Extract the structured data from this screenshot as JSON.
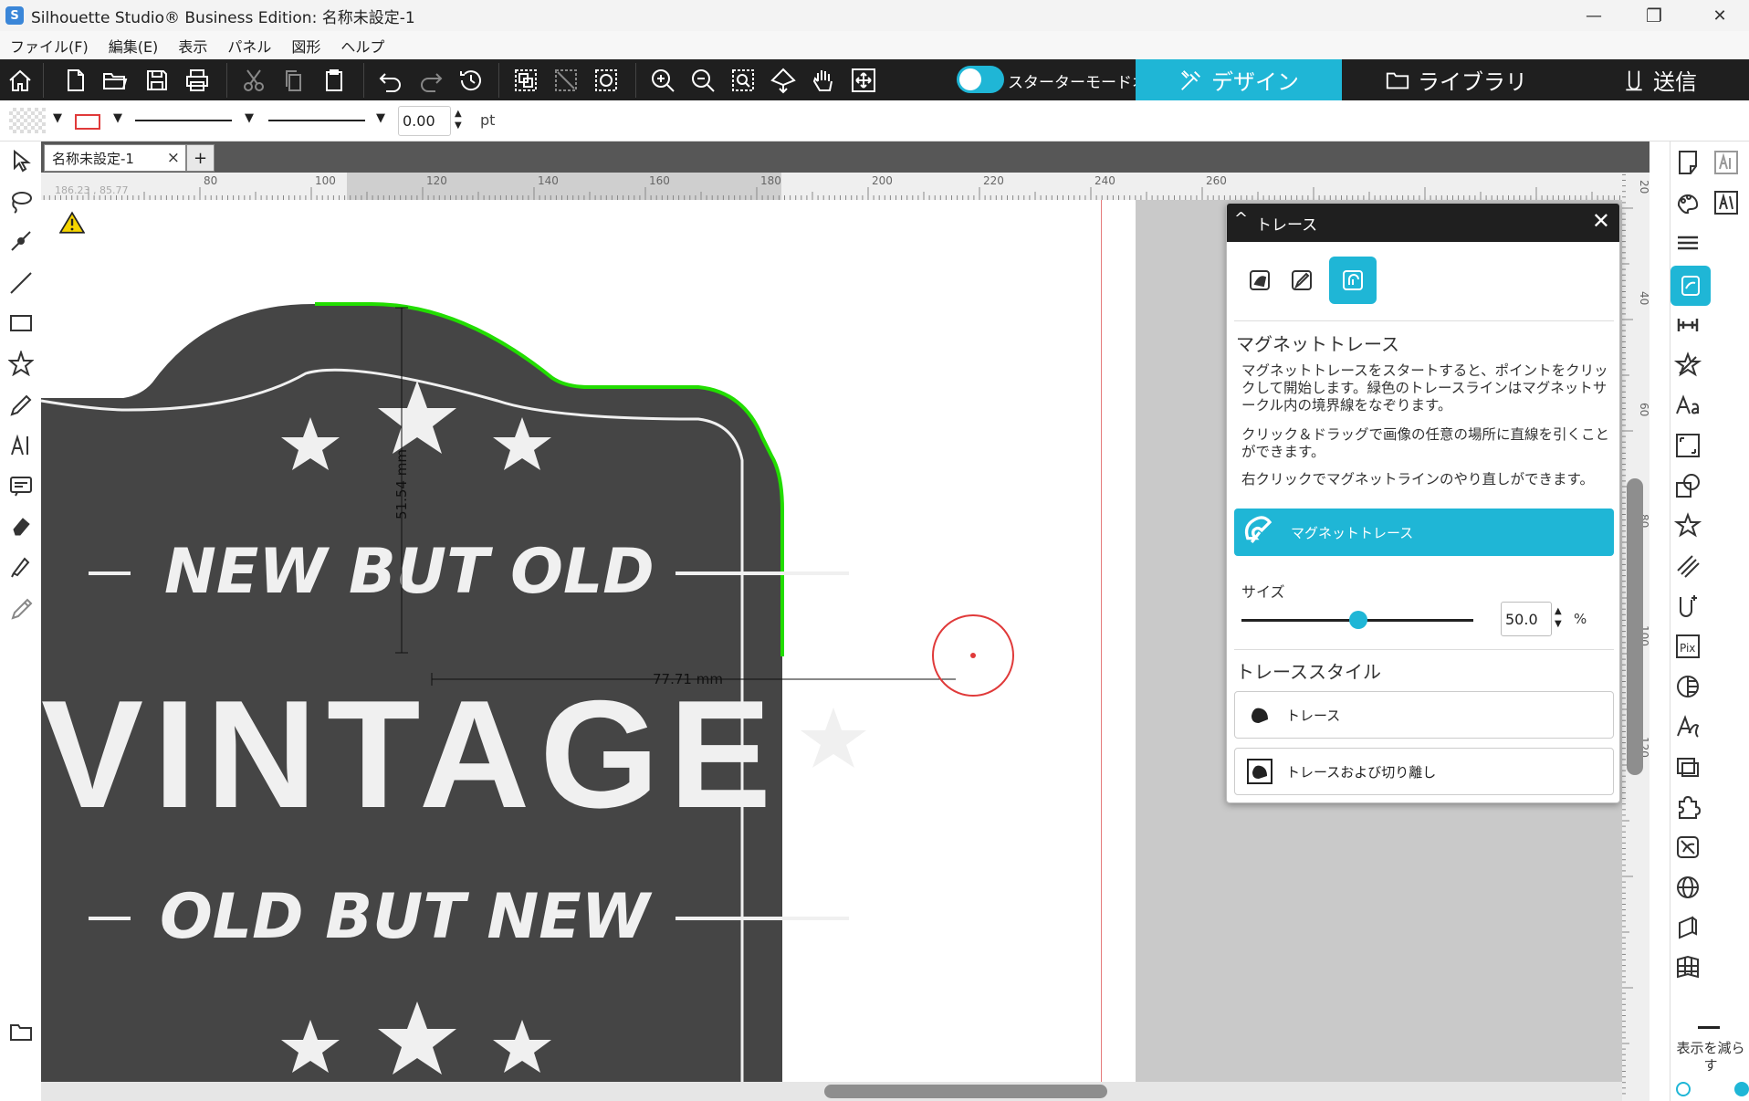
{
  "window": {
    "title": "Silhouette Studio® Business Edition: 名称未設定-1",
    "minimize": "—",
    "restore": "❐",
    "close": "✕"
  },
  "menu": [
    "ファイル(F)",
    "編集(E)",
    "表示",
    "パネル",
    "図形",
    "ヘルプ"
  ],
  "toolbar": {
    "starter_mode_label": "スターターモードオフ",
    "tabs": {
      "design": "デザイン",
      "library": "ライブラリ",
      "send": "送信"
    }
  },
  "propbar": {
    "line_width_value": "0.00",
    "unit": "pt"
  },
  "document": {
    "tab_label": "名称未設定-1",
    "tab_close": "×",
    "tab_add": "+"
  },
  "ruler_top": {
    "cursor_readout": "186.23 , 85.77",
    "ticks": [
      "80",
      "100",
      "120",
      "140",
      "160",
      "180",
      "200",
      "220",
      "240",
      "260"
    ]
  },
  "ruler_right": {
    "ticks": [
      "20",
      "40",
      "60",
      "80",
      "100",
      "120"
    ]
  },
  "canvas": {
    "dimension_height": "51.54 mm",
    "dimension_width": "77.71 mm",
    "artwork_text": {
      "line1": "NEW BUT OLD",
      "line2": "VINTAGE",
      "line3": "OLD BUT NEW"
    }
  },
  "trace_panel": {
    "title": "トレース",
    "section_magnet": "マグネットトレース",
    "para1": "マグネットトレースをスタートすると、ポイントをクリックして開始します。緑色のトレースラインはマグネットサークル内の境界線をなぞります。",
    "para2": "クリック＆ドラッグで画像の任意の場所に直線を引くことができます。",
    "para3": "右クリックでマグネットラインのやり直しができます。",
    "primary_button": "マグネットトレース",
    "size_label": "サイズ",
    "size_value": "50.0",
    "size_unit": "%",
    "size_fraction": 0.5,
    "trace_style_heading": "トレーススタイル",
    "option_trace": "トレース",
    "option_trace_cut": "トレースおよび切り離し"
  },
  "right_toolbar": {
    "reduce_display_label": "表示を減らす"
  },
  "colors": {
    "accent": "#1fb6d6",
    "toolbar_bg": "#1f1f1f",
    "artwork": "#454545",
    "trace_line": "#22dd00",
    "magnet_circle": "#e03a3a"
  }
}
